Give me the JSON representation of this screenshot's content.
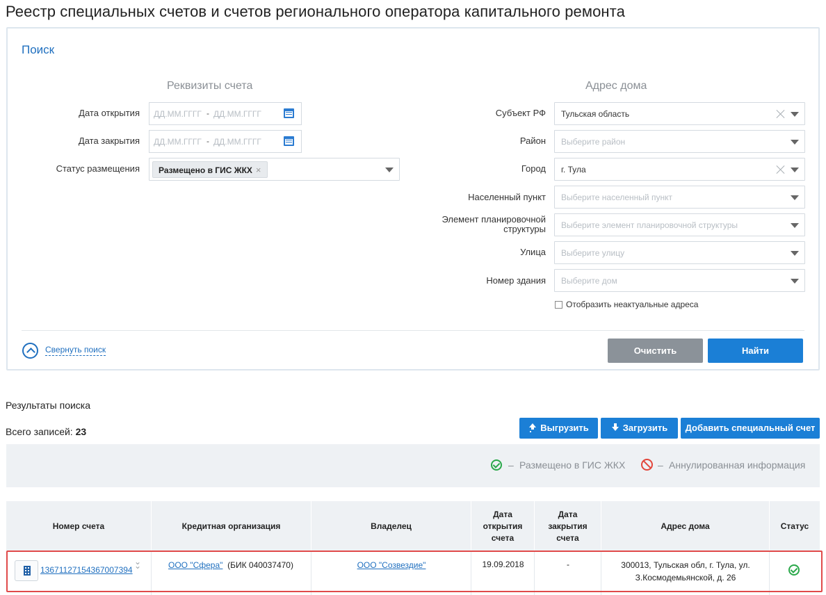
{
  "page": {
    "title": "Реестр специальных счетов и счетов регионального оператора капитального ремонта"
  },
  "search": {
    "title": "Поиск",
    "account_section_title": "Реквизиты счета",
    "address_section_title": "Адрес дома",
    "open_date": {
      "label": "Дата открытия",
      "from_placeholder": "ДД.ММ.ГГГГ",
      "separator": "-",
      "to_placeholder": "ДД.ММ.ГГГГ"
    },
    "close_date": {
      "label": "Дата закрытия",
      "from_placeholder": "ДД.ММ.ГГГГ",
      "separator": "-",
      "to_placeholder": "ДД.ММ.ГГГГ"
    },
    "placement_status": {
      "label": "Статус размещения",
      "selected_tag": "Размещено в ГИС ЖКХ",
      "tag_remove": "×"
    },
    "subject": {
      "label": "Субъект РФ",
      "value": "Тульская область"
    },
    "district": {
      "label": "Район",
      "placeholder": "Выберите район"
    },
    "city": {
      "label": "Город",
      "value": "г. Тула"
    },
    "settlement": {
      "label": "Населенный пункт",
      "placeholder": "Выберите населенный пункт"
    },
    "planning_element": {
      "label_line1": "Элемент планировочной",
      "label_line2": "структуры",
      "placeholder": "Выберите элемент планировочной структуры"
    },
    "street": {
      "label": "Улица",
      "placeholder": "Выберите улицу"
    },
    "building": {
      "label": "Номер здания",
      "placeholder": "Выберите дом"
    },
    "show_inactive_label": "Отобразить неактуальные адреса",
    "show_inactive_checked": false,
    "collapse_label": "Свернуть поиск",
    "clear_label": "Очистить",
    "find_label": "Найти"
  },
  "results": {
    "title": "Результаты поиска",
    "total_label": "Всего записей:",
    "total_count": "23",
    "export_label": "Выгрузить",
    "import_label": "Загрузить",
    "add_label": "Добавить специальный счет",
    "legend": {
      "placed_dash": "–",
      "placed": "Размещено в ГИС ЖКХ",
      "annulled_dash": "–",
      "annulled": "Аннулированная информация"
    },
    "columns": {
      "account": "Номер счета",
      "bank": "Кредитная организация",
      "owner": "Владелец",
      "open_date_l1": "Дата",
      "open_date_l2": "открытия",
      "open_date_l3": "счета",
      "close_date_l1": "Дата",
      "close_date_l2": "закрытия",
      "close_date_l3": "счета",
      "address": "Адрес дома",
      "status": "Статус"
    },
    "rows": [
      {
        "account_number": "13671127154367007394",
        "bank_name": "ООО \"Сфера\"",
        "bank_bik": "(БИК 040037470)",
        "owner": "ООО \"Созвездие\"",
        "open_date": "19.09.2018",
        "close_date": "-",
        "address_line1": "300013, Тульская обл, г. Тула, ул.",
        "address_line2": "З.Космодемьянской, д. 26",
        "status": "placed"
      }
    ]
  },
  "colors": {
    "accent": "#1b7fd6",
    "link": "#1f6fbf",
    "ok": "#2aa84a",
    "annulled": "#e2463b",
    "highlight": "#e04a4a",
    "gray_button": "#8b9299"
  }
}
